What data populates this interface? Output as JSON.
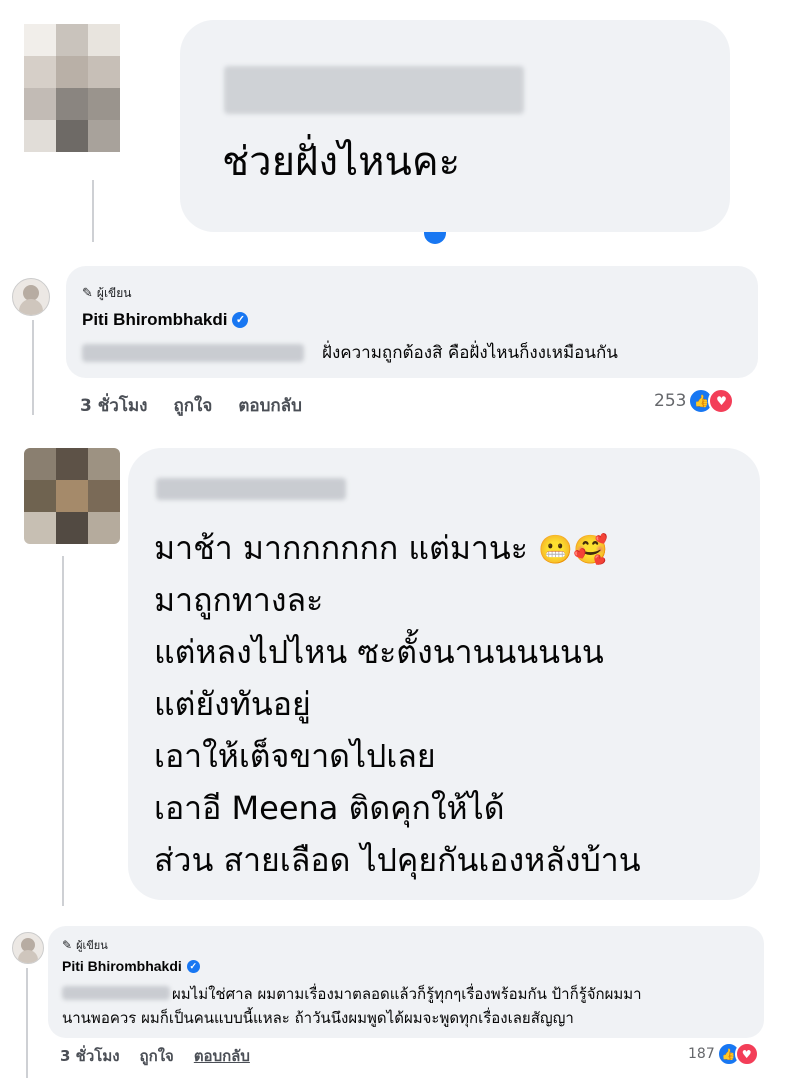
{
  "comment1": {
    "text": "ช่วยฝั่งไหนคะ"
  },
  "reply1": {
    "author_tag": "ผู้เขียน",
    "author": "Piti Bhirombhakdi",
    "text": "ฝั่งความถูกต้องสิ คือฝั่งไหนก็งงเหมือนกัน",
    "time": "3 ชั่วโมง",
    "like": "ถูกใจ",
    "reply": "ตอบกลับ",
    "reaction_count": "253"
  },
  "comment2": {
    "lines": [
      "มาช้า มากกกกกก แต่มานะ",
      "มาถูกทางละ",
      "แต่หลงไปไหน ซะตั้งนานนนนนน",
      "แต่ยังทันอยู่",
      "เอาให้เต็จขาดไปเลย",
      "เอาอี Meena ติดคุกให้ได้",
      "ส่วน สายเลือด ไปคุยกันเองหลังบ้าน"
    ],
    "emoji1": "😬",
    "emoji2": "🥰"
  },
  "reply2": {
    "author_tag": "ผู้เขียน",
    "author": "Piti Bhirombhakdi",
    "line1": "ผมไม่ใช่ศาล ผมตามเรื่องมาตลอดแล้วก็รู้ทุกๆเรื่องพร้อมกัน ป้าก็รู้จักผมมา",
    "line2": "นานพอควร ผมก็เป็นคนแบบนี้แหละ ถ้าวันนึงผมพูดได้ผมจะพูดทุกเรื่องเลยสัญญา",
    "time": "3 ชั่วโมง",
    "like": "ถูกใจ",
    "reply": "ตอบกลับ",
    "reaction_count": "187"
  },
  "colors": {
    "bubble": "#f0f2f5",
    "verified": "#1877f2",
    "like": "#1877f2",
    "love": "#f33e58"
  },
  "icons": [
    "pencil-icon",
    "verified-icon",
    "like-reaction-icon",
    "love-reaction-icon"
  ]
}
